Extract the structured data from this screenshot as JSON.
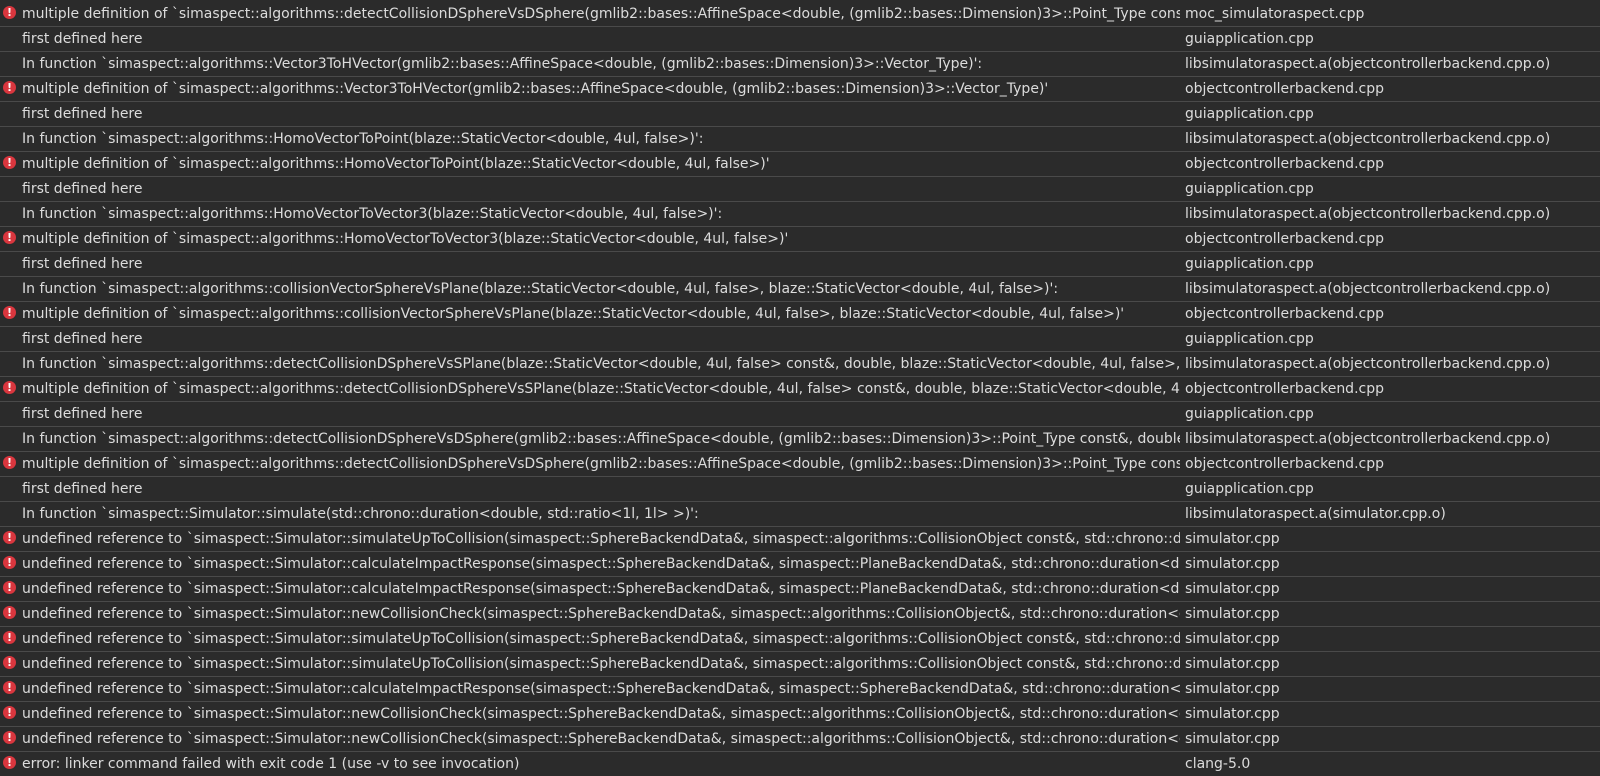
{
  "theme": {
    "background": "#2b2b2b",
    "text": "#dcdcdc",
    "separator": "#4a4a4a",
    "error_icon": "#d9363e"
  },
  "error_glyph": "!",
  "issues": [
    {
      "icon": "error",
      "message": "multiple definition of `simaspect::algorithms::detectCollisionDSphereVsDSphere(gmlib2::bases::AffineSpace<double, (gmlib2::bases::Dimension)3>::Point_Type const&, double, gmlib2::bases::AffineSpace<double, (gmlib2::bases::Dimension)3>::Vector_Type', ",
      "file": "moc_simulatoraspect.cpp"
    },
    {
      "icon": "none",
      "message": "first defined here",
      "file": "guiapplication.cpp"
    },
    {
      "icon": "none",
      "message": "In function `simaspect::algorithms::Vector3ToHVector(gmlib2::bases::AffineSpace<double, (gmlib2::bases::Dimension)3>::Vector_Type)':",
      "file": "libsimulatoraspect.a(objectcontrollerbackend.cpp.o)"
    },
    {
      "icon": "error",
      "message": "multiple definition of `simaspect::algorithms::Vector3ToHVector(gmlib2::bases::AffineSpace<double, (gmlib2::bases::Dimension)3>::Vector_Type)'",
      "file": "objectcontrollerbackend.cpp"
    },
    {
      "icon": "none",
      "message": "first defined here",
      "file": "guiapplication.cpp"
    },
    {
      "icon": "none",
      "message": "In function `simaspect::algorithms::HomoVectorToPoint(blaze::StaticVector<double, 4ul, false>)':",
      "file": "libsimulatoraspect.a(objectcontrollerbackend.cpp.o)"
    },
    {
      "icon": "error",
      "message": "multiple definition of `simaspect::algorithms::HomoVectorToPoint(blaze::StaticVector<double, 4ul, false>)'",
      "file": "objectcontrollerbackend.cpp"
    },
    {
      "icon": "none",
      "message": "first defined here",
      "file": "guiapplication.cpp"
    },
    {
      "icon": "none",
      "message": "In function `simaspect::algorithms::HomoVectorToVector3(blaze::StaticVector<double, 4ul, false>)':",
      "file": "libsimulatoraspect.a(objectcontrollerbackend.cpp.o)"
    },
    {
      "icon": "error",
      "message": "multiple definition of `simaspect::algorithms::HomoVectorToVector3(blaze::StaticVector<double, 4ul, false>)'",
      "file": "objectcontrollerbackend.cpp"
    },
    {
      "icon": "none",
      "message": "first defined here",
      "file": "guiapplication.cpp"
    },
    {
      "icon": "none",
      "message": "In function `simaspect::algorithms::collisionVectorSphereVsPlane(blaze::StaticVector<double, 4ul, false>, blaze::StaticVector<double, 4ul, false>)':",
      "file": "libsimulatoraspect.a(objectcontrollerbackend.cpp.o)"
    },
    {
      "icon": "error",
      "message": "multiple definition of `simaspect::algorithms::collisionVectorSphereVsPlane(blaze::StaticVector<double, 4ul, false>, blaze::StaticVector<double, 4ul, false>)'",
      "file": "objectcontrollerbackend.cpp"
    },
    {
      "icon": "none",
      "message": "first defined here",
      "file": "guiapplication.cpp"
    },
    {
      "icon": "none",
      "message": "In function `simaspect::algorithms::detectCollisionDSphereVsSPlane(blaze::StaticVector<double, 4ul, false> const&, double, blaze::StaticVector<double, 4ul, false>, blaze::StaticVector<double, 4ul, false>",
      "file": "libsimulatoraspect.a(objectcontrollerbackend.cpp.o)"
    },
    {
      "icon": "error",
      "message": "multiple definition of `simaspect::algorithms::detectCollisionDSphereVsSPlane(blaze::StaticVector<double, 4ul, false> const&, double, blaze::StaticVector<double, 4ul, false>",
      "file": "objectcontrollerbackend.cpp"
    },
    {
      "icon": "none",
      "message": "first defined here",
      "file": "guiapplication.cpp"
    },
    {
      "icon": "none",
      "message": "In function `simaspect::algorithms::detectCollisionDSphereVsDSphere(gmlib2::bases::AffineSpace<double, (gmlib2::bases::Dimension)3>::Point_Type const&, double, gmlib2::bases::AffineSpace",
      "file": "libsimulatoraspect.a(objectcontrollerbackend.cpp.o)"
    },
    {
      "icon": "error",
      "message": "multiple definition of `simaspect::algorithms::detectCollisionDSphereVsDSphere(gmlib2::bases::AffineSpace<double, (gmlib2::bases::Dimension)3>::Point_Type const&, double",
      "file": "objectcontrollerbackend.cpp"
    },
    {
      "icon": "none",
      "message": "first defined here",
      "file": "guiapplication.cpp"
    },
    {
      "icon": "none",
      "message": "In function `simaspect::Simulator::simulate(std::chrono::duration<double, std::ratio<1l, 1l> >)':",
      "file": "libsimulatoraspect.a(simulator.cpp.o)"
    },
    {
      "icon": "error",
      "message": "undefined reference to `simaspect::Simulator::simulateUpToCollision(simaspect::SphereBackendData&, simaspect::algorithms::CollisionObject const&, std::chrono::duration<double",
      "file": "simulator.cpp"
    },
    {
      "icon": "error",
      "message": "undefined reference to `simaspect::Simulator::calculateImpactResponse(simaspect::SphereBackendData&, simaspect::PlaneBackendData&, std::chrono::duration<double",
      "file": "simulator.cpp"
    },
    {
      "icon": "error",
      "message": "undefined reference to `simaspect::Simulator::calculateImpactResponse(simaspect::SphereBackendData&, simaspect::PlaneBackendData&, std::chrono::duration<double",
      "file": "simulator.cpp"
    },
    {
      "icon": "error",
      "message": "undefined reference to `simaspect::Simulator::newCollisionCheck(simaspect::SphereBackendData&, simaspect::algorithms::CollisionObject&, std::chrono::duration<double",
      "file": "simulator.cpp"
    },
    {
      "icon": "error",
      "message": "undefined reference to `simaspect::Simulator::simulateUpToCollision(simaspect::SphereBackendData&, simaspect::algorithms::CollisionObject const&, std::chrono::duration<double",
      "file": "simulator.cpp"
    },
    {
      "icon": "error",
      "message": "undefined reference to `simaspect::Simulator::simulateUpToCollision(simaspect::SphereBackendData&, simaspect::algorithms::CollisionObject const&, std::chrono::duration<double",
      "file": "simulator.cpp"
    },
    {
      "icon": "error",
      "message": "undefined reference to `simaspect::Simulator::calculateImpactResponse(simaspect::SphereBackendData&, simaspect::SphereBackendData&, std::chrono::duration<double",
      "file": "simulator.cpp"
    },
    {
      "icon": "error",
      "message": "undefined reference to `simaspect::Simulator::newCollisionCheck(simaspect::SphereBackendData&, simaspect::algorithms::CollisionObject&, std::chrono::duration<double",
      "file": "simulator.cpp"
    },
    {
      "icon": "error",
      "message": "undefined reference to `simaspect::Simulator::newCollisionCheck(simaspect::SphereBackendData&, simaspect::algorithms::CollisionObject&, std::chrono::duration<double",
      "file": "simulator.cpp"
    },
    {
      "icon": "error",
      "message": "error: linker command failed with exit code 1 (use -v to see invocation)",
      "file": "clang-5.0"
    }
  ]
}
